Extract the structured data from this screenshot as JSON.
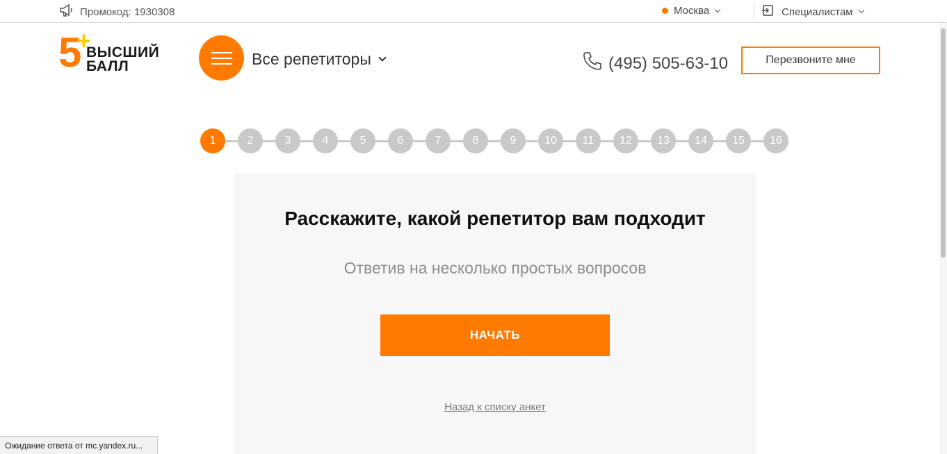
{
  "topbar": {
    "promo_text": "Промокод: 1930308",
    "city": "Москва",
    "specialists": "Специалистам"
  },
  "header": {
    "logo_digit": "5",
    "logo_plus": "+",
    "logo_line1": "ВЫСШИЙ",
    "logo_line2": "БАЛЛ",
    "all_tutors": "Все репетиторы",
    "phone": "(495) 505-63-10",
    "callback_button": "Перезвоните мне"
  },
  "steps": {
    "items": [
      "1",
      "2",
      "3",
      "4",
      "5",
      "6",
      "7",
      "8",
      "9",
      "10",
      "11",
      "12",
      "13",
      "14",
      "15",
      "16"
    ],
    "active": 1
  },
  "card": {
    "title": "Расскажите, какой репетитор вам подходит",
    "subtitle": "Ответив на несколько простых вопросов",
    "start_button": "НАЧАТЬ",
    "back_link": "Назад к списку анкет"
  },
  "statusbar": {
    "text": "Ожидание ответа от mc.yandex.ru..."
  },
  "colors": {
    "accent": "#ff7a00",
    "logo_plus": "#ffcc00",
    "step_inactive": "#c9c9c9",
    "card_bg": "#f7f7f7"
  }
}
